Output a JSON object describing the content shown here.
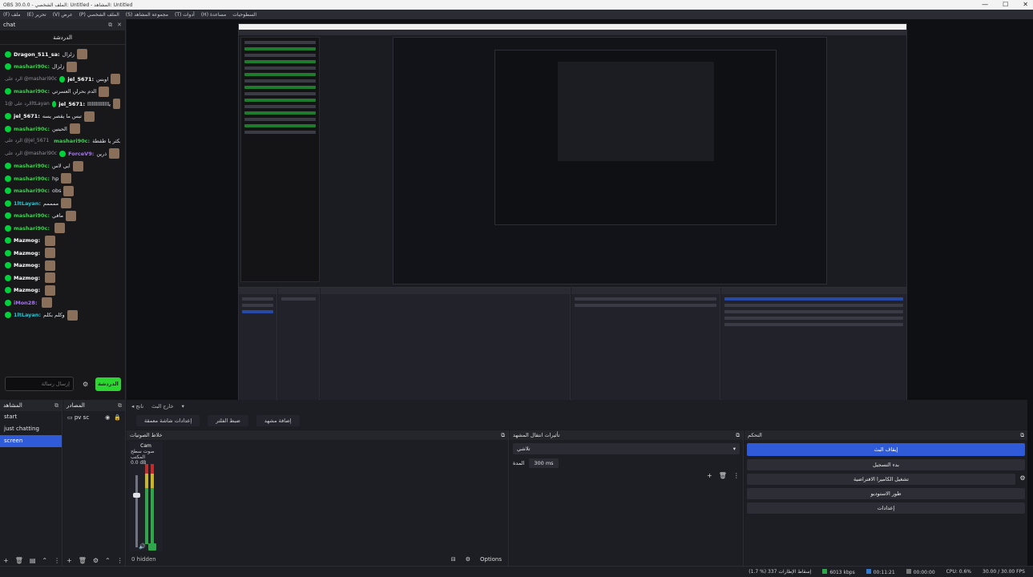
{
  "window": {
    "title": "OBS 30.0.0 - الملف الشخصي: Untitled - المشاهد: Untitled",
    "controls": [
      "—",
      "☐",
      "✕"
    ]
  },
  "menu": [
    "(F) ملف",
    "(E) تحرير",
    "(V) عرض",
    "(P) الملف الشخصي",
    "(S) مجموعة المشاهد",
    "(T) أدوات",
    "(H) مساعدة",
    "السطوحيات"
  ],
  "chat": {
    "dock_title": "chat",
    "header": "الدردشة",
    "messages": [
      {
        "user": "Dragon_511_sa:",
        "text": "زلزال",
        "color": "white",
        "reply": ""
      },
      {
        "user": "mashari90c:",
        "text": "زلزال",
        "color": "green",
        "reply": ""
      },
      {
        "user": "jel_5671:",
        "text": "اوبس",
        "color": "white",
        "reply": "الرد على @mashari90c"
      },
      {
        "user": "mashari90c:",
        "text": "الدم بحرلن العسرتي",
        "color": "green",
        "reply": ""
      },
      {
        "user": "jel_5671:",
        "text": "يااااااااااااااا",
        "color": "white",
        "reply": "الرد على @1ltLayan"
      },
      {
        "user": "jel_5671:",
        "text": "تبس ما يقصر يسه",
        "color": "white",
        "reply": ""
      },
      {
        "user": "mashari90c:",
        "text": "الحيتين",
        "color": "green",
        "reply": ""
      },
      {
        "user": "mashari90c:",
        "text": "الله يكثر يا طقطة",
        "color": "green",
        "reply": "الرد على @jel_5671"
      },
      {
        "user": "ForceV9:",
        "text": "ذرين",
        "color": "purple",
        "reply": "الرد على @mashari90c"
      },
      {
        "user": "mashari90c:",
        "text": "ايي لاس",
        "color": "green",
        "reply": ""
      },
      {
        "user": "mashari90c:",
        "text": "hp",
        "color": "green",
        "reply": ""
      },
      {
        "user": "mashari90c:",
        "text": "obs",
        "color": "green",
        "reply": ""
      },
      {
        "user": "1ltLayan:",
        "text": "ممممم",
        "color": "cyan",
        "reply": ""
      },
      {
        "user": "mashari90c:",
        "text": "مافي",
        "color": "green",
        "reply": ""
      },
      {
        "user": "mashari90c:",
        "text": "",
        "color": "green",
        "reply": ""
      },
      {
        "user": "Mazmog:",
        "text": "",
        "color": "white",
        "reply": ""
      },
      {
        "user": "Mazmog:",
        "text": "",
        "color": "white",
        "reply": ""
      },
      {
        "user": "Mazmog:",
        "text": "",
        "color": "white",
        "reply": ""
      },
      {
        "user": "Mazmog:",
        "text": "",
        "color": "white",
        "reply": ""
      },
      {
        "user": "Mazmog:",
        "text": "",
        "color": "white",
        "reply": ""
      },
      {
        "user": "iMon28:",
        "text": "",
        "color": "purple",
        "reply": ""
      },
      {
        "user": "1ltLayan:",
        "text": "وكلم بكلم",
        "color": "cyan",
        "reply": ""
      }
    ],
    "input_placeholder": "إرسال رسالة",
    "send_label": "الدردشة"
  },
  "scenes": {
    "title": "المشاهد",
    "items": [
      "start",
      "just chatting",
      "screen"
    ],
    "selected": 2
  },
  "sources": {
    "title": "المصادر",
    "items": [
      {
        "name": "pv sc"
      }
    ]
  },
  "toolbar": {
    "items": [
      "◂ ناتج",
      "خارج البث",
      "▾"
    ]
  },
  "tabs": [
    "إعدادات شاشة معمقة",
    "ضبط الفلتر",
    "إضافة مشهد"
  ],
  "mixer": {
    "title": "خلاط الصوتيات",
    "channel": "Cam",
    "device": "صوت سطح المكتب",
    "db": "0.0 dB",
    "hidden": "0 hidden",
    "options": "Options"
  },
  "transitions": {
    "title": "تأثيرات انتقال المشهد",
    "type": "تلاشي",
    "duration_label": "المدة",
    "duration": "300 ms"
  },
  "controls": {
    "title": "التحكم",
    "start_stream": "إيقاف البث",
    "start_record": "بدء التسجيل",
    "virtual_cam": "تشغيل الكاميرا الافتراضية",
    "studio_mode": "طور الاستوديو",
    "settings": "إعدادات"
  },
  "status": {
    "dropped": "(1.7 %) 337 إسقاط الإطارات",
    "bitrate": "6013 kbps",
    "stream_time": "00:11:21",
    "rec_time": "00:00:00",
    "cpu": "CPU: 0.6%",
    "fps": "30.00 / 30.00 FPS"
  }
}
